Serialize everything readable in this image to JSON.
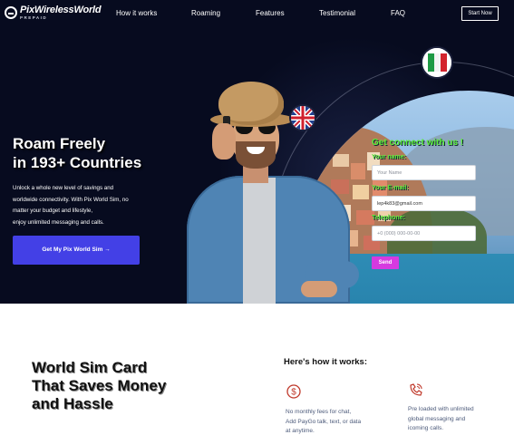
{
  "nav": {
    "logo_text": "PixWirelessWorld",
    "logo_sub": "PREPAID",
    "links": [
      "How it works",
      "Roaming",
      "Features",
      "Testimonial",
      "FAQ"
    ],
    "start_button": "Start Now"
  },
  "hero": {
    "title_line1": "Roam Freely",
    "title_line2": "in 193+ Countries",
    "description_lines": [
      "Unlock a whole new level of savings and",
      "worldwide connectivity. With Pix World Sim, no",
      "matter your budget and lifestyle,",
      "enjoy unlimited messaging and calls."
    ],
    "cta_label": "Get My Pix World Sim →"
  },
  "form": {
    "title": "Get connect with us !",
    "name_label": "Your name:",
    "name_placeholder": "Your Name",
    "email_label": "Your E-mail:",
    "email_value": "lep4k83@gmail.com",
    "phone_label": "Telephone:",
    "phone_placeholder": "+0 (000) 000-00-00",
    "send_label": "Send"
  },
  "section": {
    "title_lines": [
      "World Sim Card",
      "That Saves Money",
      "and Hassle"
    ],
    "how_title": "Here's how it works:",
    "features": [
      {
        "icon": "dollar-icon",
        "lines": [
          "No monthly fees for chat,",
          "Add PayGo talk, text, or data",
          "at anytime."
        ]
      },
      {
        "icon": "phone-call-icon",
        "lines": [
          "Pre loaded with unlimited",
          "global messaging and",
          "icoming calls."
        ]
      }
    ]
  },
  "colors": {
    "hero_bg": "#070b1f",
    "cta": "#4340e6",
    "form_green": "#5bf03a",
    "send": "#d63ae0",
    "feature_icon": "#c0392b"
  }
}
